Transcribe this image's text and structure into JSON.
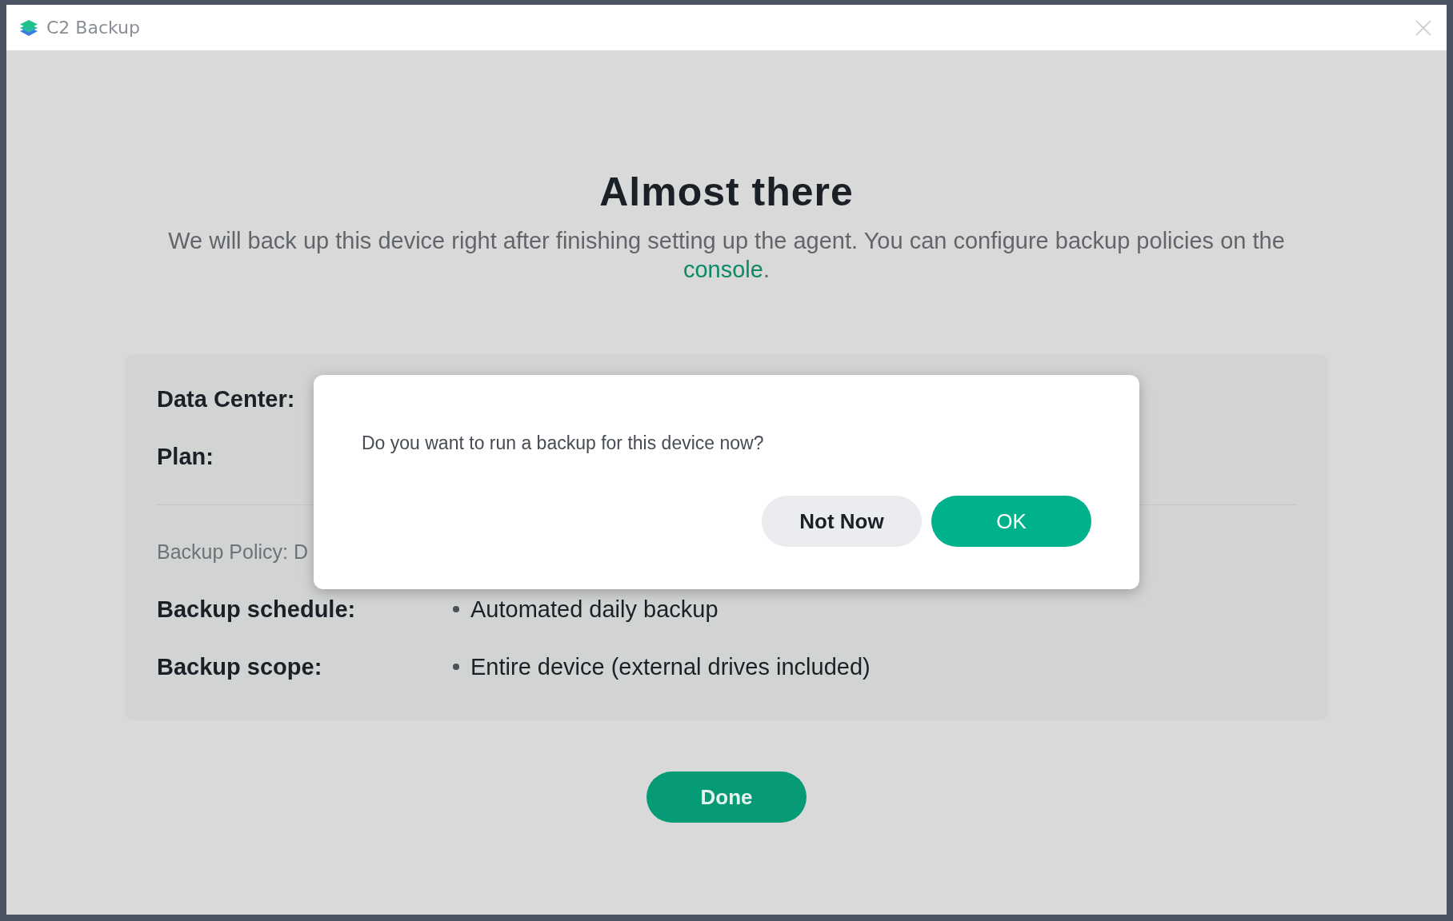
{
  "window": {
    "title": "C2 Backup"
  },
  "heading": "Almost there",
  "intro": {
    "text": "We will back up this device right after finishing setting up the agent. You can configure backup policies on the",
    "link": "console",
    "end": "."
  },
  "summary": {
    "labels": [
      "Data Center:",
      "Plan:"
    ],
    "policy": "Backup Policy: D",
    "rows": [
      {
        "label": "Backup schedule:",
        "value": "Automated daily backup"
      },
      {
        "label": "Backup scope:",
        "value": "Entire device (external drives included)"
      }
    ]
  },
  "dialog": {
    "message": "Do you want to run a backup for this device now?",
    "buttons": [
      {
        "label": "Not Now",
        "kind": "secondary"
      },
      {
        "label": "OK",
        "kind": "primary"
      }
    ]
  },
  "done_button": "Done"
}
